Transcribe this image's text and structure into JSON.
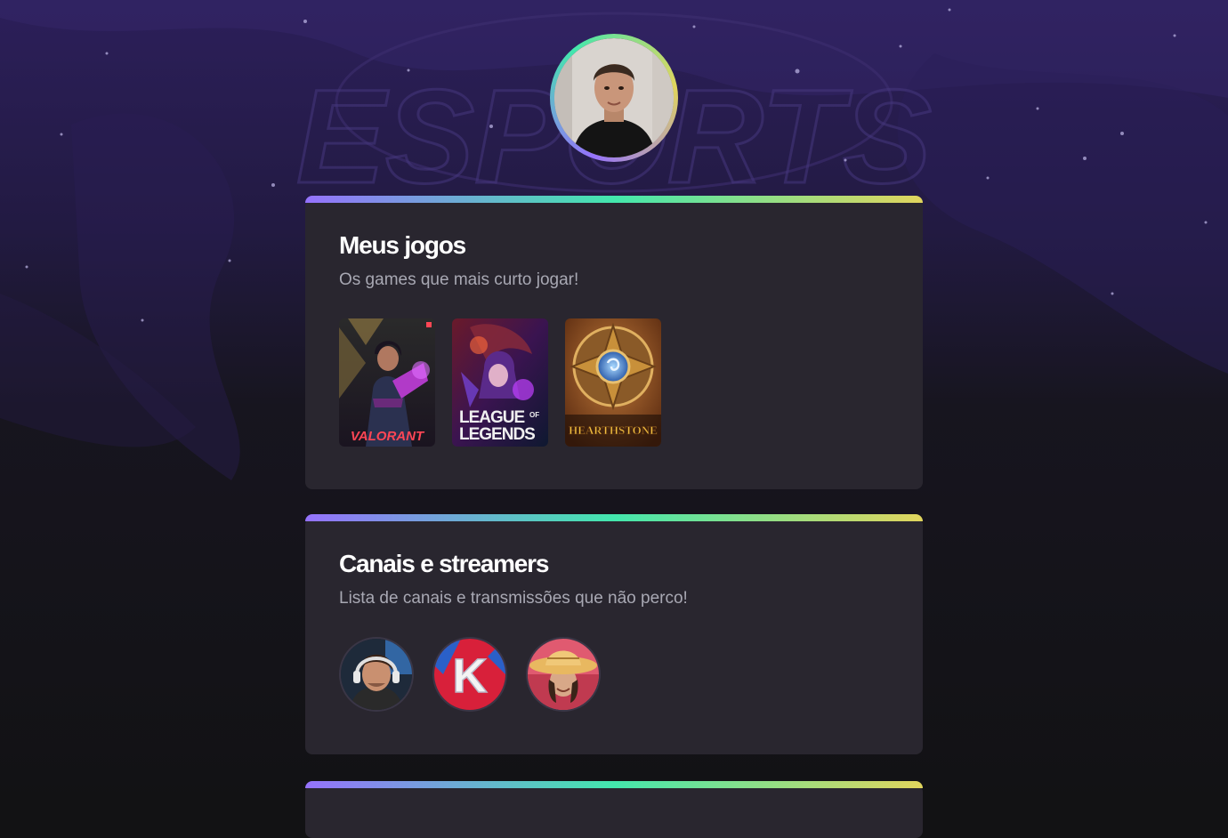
{
  "background": {
    "watermark_text": "ESPORTS",
    "colors": {
      "top": "#2c1f5a",
      "bottom": "#121214"
    }
  },
  "profile": {
    "avatar_alt": "profile photo"
  },
  "sections": [
    {
      "title": "Meus jogos",
      "subtitle": "Os games que mais curto jogar!",
      "games": [
        {
          "name": "VALORANT",
          "icon": "valorant-cover"
        },
        {
          "name_line1": "LEAGUE",
          "name_of": "OF",
          "name_line2": "LEGENDS",
          "icon": "league-of-legends-cover"
        },
        {
          "name": "HEARTHSTONE",
          "icon": "hearthstone-cover"
        }
      ]
    },
    {
      "title": "Canais e streamers",
      "subtitle": "Lista de canais e transmissões que não perco!",
      "streamers": [
        {
          "icon": "streamer-headset-avatar"
        },
        {
          "icon": "streamer-k-logo-avatar",
          "logo_letter": "K"
        },
        {
          "icon": "streamer-hat-avatar"
        }
      ]
    }
  ],
  "accent_gradient": [
    "#9572fc",
    "#43e7ad",
    "#e1d55d"
  ]
}
